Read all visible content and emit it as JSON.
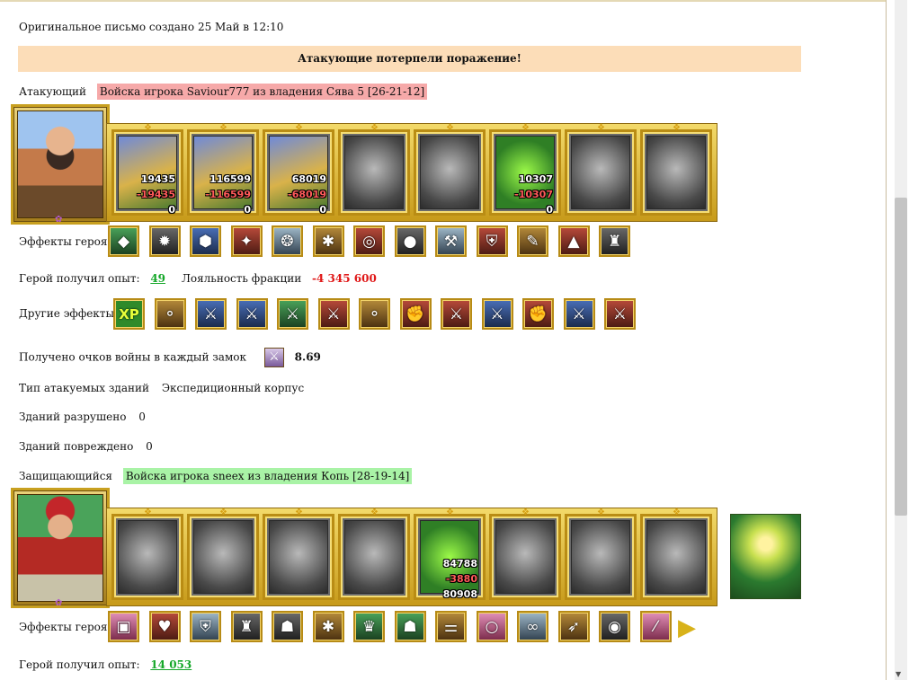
{
  "created_line": "Оригинальное письмо создано 25 Май в 12:10",
  "result_banner": "Атакующие потерпели поражение!",
  "attacker": {
    "label": "Атакующий",
    "player": "Войска игрока Saviour777 из владения Сява 5 [26-21-12]",
    "slots": [
      {
        "style": "color",
        "n1": "19435",
        "n2": "-19435",
        "n3": "0"
      },
      {
        "style": "color",
        "n1": "116599",
        "n2": "-116599",
        "n3": "0"
      },
      {
        "style": "color",
        "n1": "68019",
        "n2": "-68019",
        "n3": "0"
      },
      {
        "style": "gray"
      },
      {
        "style": "gray"
      },
      {
        "style": "color-green",
        "n1": "10307",
        "n2": "-10307",
        "n3": "0"
      },
      {
        "style": "gray"
      },
      {
        "style": "gray"
      }
    ],
    "hero_effects_label": "Эффекты героя:",
    "hero_effect_icons": [
      {
        "name": "diamond-ring-icon",
        "glyph": "◆",
        "bg": "bg-green"
      },
      {
        "name": "dark-amulet-icon",
        "glyph": "✹",
        "bg": "bg-dark"
      },
      {
        "name": "blue-gem-icon",
        "glyph": "⬢",
        "bg": "bg-blue"
      },
      {
        "name": "pink-boot-icon",
        "glyph": "✦",
        "bg": "bg-red"
      },
      {
        "name": "silver-pendant-icon",
        "glyph": "❂",
        "bg": "bg-steel"
      },
      {
        "name": "spider-amulet-icon",
        "glyph": "✱",
        "bg": "bg-gold"
      },
      {
        "name": "bracelet-icon",
        "glyph": "◎",
        "bg": "bg-red"
      },
      {
        "name": "cauldron-icon",
        "glyph": "●",
        "bg": "bg-dark"
      },
      {
        "name": "axe-icon",
        "glyph": "⚒",
        "bg": "bg-steel"
      },
      {
        "name": "shield-icon",
        "glyph": "⛨",
        "bg": "bg-red"
      },
      {
        "name": "scroll-icon",
        "glyph": "✎",
        "bg": "bg-gold"
      },
      {
        "name": "cloak-icon",
        "glyph": "▲",
        "bg": "bg-red"
      },
      {
        "name": "armor-icon",
        "glyph": "♜",
        "bg": "bg-dark"
      }
    ],
    "xp_label": "Герой получил опыт:",
    "xp_value": "49",
    "loyalty_label": "Лояльность фракции",
    "loyalty_value": "-4 345 600",
    "other_effects_label": "Другие эффекты:",
    "other_effect_icons": [
      {
        "name": "xp-bonus-icon",
        "glyph": "XP",
        "bg": "xp"
      },
      {
        "name": "coins-icon",
        "glyph": "⚬",
        "bg": "bg-gold"
      },
      {
        "name": "sword-icon",
        "glyph": "⚔",
        "bg": "bg-blue"
      },
      {
        "name": "sword-icon",
        "glyph": "⚔",
        "bg": "bg-blue"
      },
      {
        "name": "green-sword-icon",
        "glyph": "⚔",
        "bg": "bg-green"
      },
      {
        "name": "red-fist-sword-icon",
        "glyph": "⚔",
        "bg": "bg-red"
      },
      {
        "name": "coins-icon",
        "glyph": "⚬",
        "bg": "bg-gold"
      },
      {
        "name": "fist-icon",
        "glyph": "✊",
        "bg": "bg-red"
      },
      {
        "name": "red-fist-sword-icon",
        "glyph": "⚔",
        "bg": "bg-red"
      },
      {
        "name": "sword-icon",
        "glyph": "⚔",
        "bg": "bg-blue"
      },
      {
        "name": "fist-icon",
        "glyph": "✊",
        "bg": "bg-red"
      },
      {
        "name": "sword-icon",
        "glyph": "⚔",
        "bg": "bg-blue"
      },
      {
        "name": "red-fist-sword-icon",
        "glyph": "⚔",
        "bg": "bg-red"
      }
    ],
    "war_points_label": "Получено очков войны в каждый замок",
    "war_points_value": "8.69",
    "building_type_label": "Тип атакуемых зданий",
    "building_type_value": "Экспедиционный корпус",
    "destroyed_label": "Зданий разрушено",
    "destroyed_value": "0",
    "damaged_label": "Зданий повреждено",
    "damaged_value": "0"
  },
  "defender": {
    "label": "Защищающийся",
    "player": "Войска игрока sneex из владения Копь [28-19-14]",
    "slots": [
      {
        "style": "gray"
      },
      {
        "style": "gray"
      },
      {
        "style": "gray"
      },
      {
        "style": "gray"
      },
      {
        "style": "color-green",
        "n1": "84788",
        "n2": "-3880",
        "n3": "80908"
      },
      {
        "style": "gray"
      },
      {
        "style": "gray"
      },
      {
        "style": "gray"
      }
    ],
    "hero_effects_label": "Эффекты героя:",
    "hero_effect_icons": [
      {
        "name": "pink-chest-icon",
        "glyph": "▣",
        "bg": "bg-pink"
      },
      {
        "name": "heart-icon",
        "glyph": "♥",
        "bg": "bg-red"
      },
      {
        "name": "shield-icon",
        "glyph": "⛨",
        "bg": "bg-steel"
      },
      {
        "name": "armor-icon",
        "glyph": "♜",
        "bg": "bg-dark"
      },
      {
        "name": "mask-icon",
        "glyph": "☗",
        "bg": "bg-dark"
      },
      {
        "name": "spider-amulet-icon",
        "glyph": "✱",
        "bg": "bg-gold"
      },
      {
        "name": "green-crown-icon",
        "glyph": "♛",
        "bg": "bg-green"
      },
      {
        "name": "green-helmet-icon",
        "glyph": "☗",
        "bg": "bg-green"
      },
      {
        "name": "boots-icon",
        "glyph": "⚌",
        "bg": "bg-gold"
      },
      {
        "name": "ring-icon",
        "glyph": "○",
        "bg": "bg-pink"
      },
      {
        "name": "necklace-icon",
        "glyph": "∞",
        "bg": "bg-steel"
      },
      {
        "name": "bow-icon",
        "glyph": "➶",
        "bg": "bg-gold"
      },
      {
        "name": "orb-icon",
        "glyph": "◉",
        "bg": "bg-dark"
      },
      {
        "name": "wand-icon",
        "glyph": "⁄",
        "bg": "bg-pink"
      }
    ],
    "xp_label": "Герой получил опыт:",
    "xp_value": "14 053"
  }
}
